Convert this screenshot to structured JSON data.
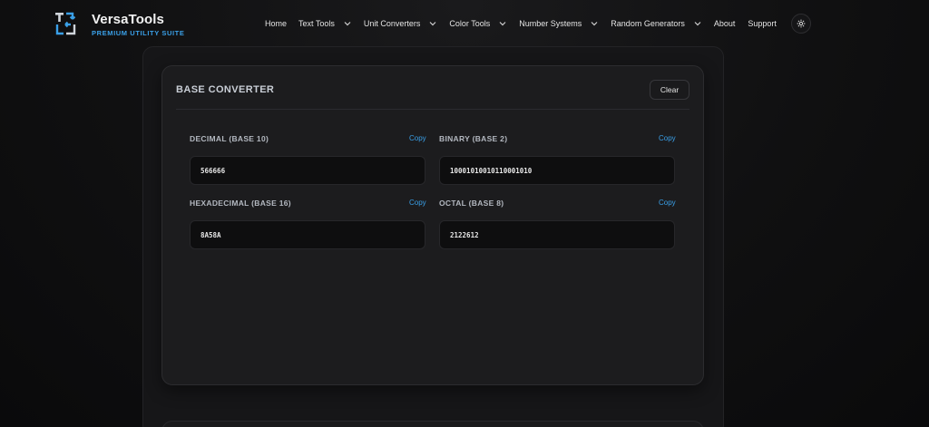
{
  "brand": {
    "name": "VersaTools",
    "tagline": "PREMIUM UTILITY SUITE",
    "accent": "#3aa0e8"
  },
  "nav": {
    "items": [
      {
        "label": "Home",
        "dropdown": false
      },
      {
        "label": "Text Tools",
        "dropdown": true
      },
      {
        "label": "Unit Converters",
        "dropdown": true
      },
      {
        "label": "Color Tools",
        "dropdown": true
      },
      {
        "label": "Number Systems",
        "dropdown": true
      },
      {
        "label": "Random Generators",
        "dropdown": true
      },
      {
        "label": "About",
        "dropdown": false
      },
      {
        "label": "Support",
        "dropdown": false
      }
    ],
    "settings_icon": "gear-icon"
  },
  "converter": {
    "title": "BASE CONVERTER",
    "clear_label": "Clear",
    "copy_label": "Copy",
    "fields": {
      "decimal": {
        "label": "DECIMAL (BASE 10)",
        "value": "566666"
      },
      "binary": {
        "label": "BINARY (BASE 2)",
        "value": "10001010010110001010"
      },
      "hex": {
        "label": "HEXADECIMAL (BASE 16)",
        "value": "8A58A"
      },
      "octal": {
        "label": "OCTAL (BASE 8)",
        "value": "2122612"
      }
    }
  }
}
